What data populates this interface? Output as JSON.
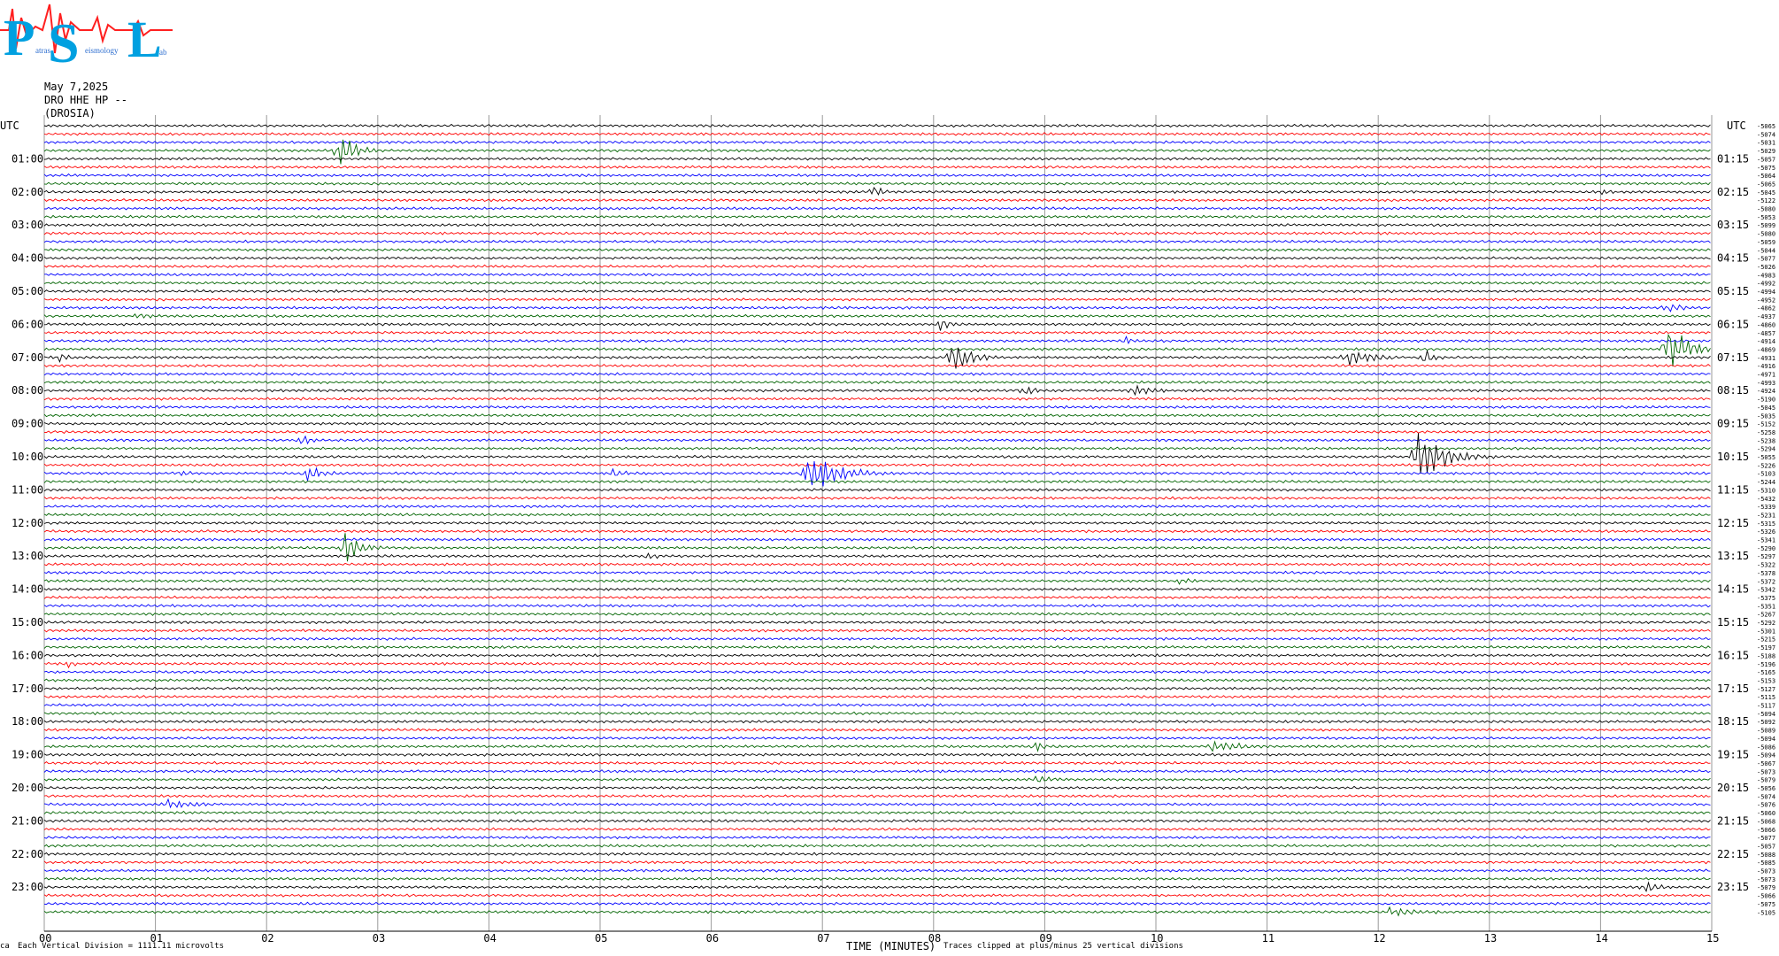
{
  "logo": {
    "letters": [
      "P",
      "S",
      "L"
    ],
    "small_words": [
      "atras",
      "eismology",
      "ab"
    ],
    "colors": {
      "letter": "#00a0e0",
      "wave": "#ff2020"
    }
  },
  "header": {
    "date": "May 7,2025",
    "station": "DRO HHE HP --",
    "location": "(DROSIA)"
  },
  "labels": {
    "utc_left": "UTC",
    "utc_right": "UTC",
    "time_axis": "TIME (MINUTES)",
    "division": "Each Vertical Division = 1111.11 microvolts",
    "clip_note": "Traces clipped at plus/minus 25 vertical divisions",
    "corner_mark": "ca"
  },
  "chart_data": {
    "type": "line",
    "x_axis": {
      "label": "TIME (MINUTES)",
      "range": [
        0,
        15
      ],
      "ticks": [
        "00",
        "01",
        "02",
        "03",
        "04",
        "05",
        "06",
        "07",
        "08",
        "09",
        "10",
        "11",
        "12",
        "13",
        "14",
        "15"
      ]
    },
    "row_minutes": 15,
    "rows_total": 96,
    "trace_color_cycle": [
      "#000000",
      "#ff0000",
      "#0000ff",
      "#006400"
    ],
    "left_hour_labels": [
      "01:00",
      "02:00",
      "03:00",
      "04:00",
      "05:00",
      "06:00",
      "07:00",
      "08:00",
      "09:00",
      "10:00",
      "11:00",
      "12:00",
      "13:00",
      "14:00",
      "15:00",
      "16:00",
      "17:00",
      "18:00",
      "19:00",
      "20:00",
      "21:00",
      "22:00",
      "23:00"
    ],
    "right_hour_labels": [
      "01:15",
      "02:15",
      "03:15",
      "04:15",
      "05:15",
      "06:15",
      "07:15",
      "08:15",
      "09:15",
      "10:15",
      "11:15",
      "12:15",
      "13:15",
      "14:15",
      "15:15",
      "16:15",
      "17:15",
      "18:15",
      "19:15",
      "20:15",
      "21:15",
      "22:15",
      "23:15"
    ],
    "offsets": [
      "-5065",
      "-5074",
      "-5031",
      "-5029",
      "-5057",
      "-5075",
      "-5064",
      "-5065",
      "-5045",
      "-5122",
      "-5080",
      "-5053",
      "-5099",
      "-5080",
      "-5059",
      "-5044",
      "-5077",
      "-5026",
      "-4983",
      "-4992",
      "-4994",
      "-4952",
      "-4862",
      "-4937",
      "-4860",
      "-4857",
      "-4914",
      "-4869",
      "-4931",
      "-4916",
      "-4971",
      "-4993",
      "-4924",
      "-5190",
      "-5045",
      "-5035",
      "-5152",
      "-5258",
      "-5238",
      "-5294",
      "-5055",
      "-5226",
      "-5103",
      "-5244",
      "-5310",
      "-5432",
      "-5339",
      "-5231",
      "-5315",
      "-5326",
      "-5341",
      "-5290",
      "-5297",
      "-5322",
      "-5378",
      "-5372",
      "-5342",
      "-5375",
      "-5351",
      "-5267",
      "-5292",
      "-5301",
      "-5215",
      "-5197",
      "-5188",
      "-5196",
      "-5165",
      "-5153",
      "-5127",
      "-5115",
      "-5117",
      "-5094",
      "-5092",
      "-5089",
      "-5094",
      "-5086",
      "-5094",
      "-5067",
      "-5073",
      "-5079",
      "-5056",
      "-5074",
      "-5076",
      "-5060",
      "-5068",
      "-5066",
      "-5077",
      "-5057",
      "-5088",
      "-5085",
      "-5073",
      "-5073",
      "-5079",
      "-5066",
      "-5075",
      "-5105"
    ],
    "events": [
      {
        "row": 3,
        "minute": 2.65,
        "duration": 0.4,
        "amp": 30
      },
      {
        "row": 8,
        "minute": 7.45,
        "duration": 0.3,
        "amp": 10
      },
      {
        "row": 8,
        "minute": 14.0,
        "duration": 0.3,
        "amp": 6
      },
      {
        "row": 23,
        "minute": 0.8,
        "duration": 0.6,
        "amp": 5
      },
      {
        "row": 22,
        "minute": 14.6,
        "duration": 0.4,
        "amp": 10
      },
      {
        "row": 24,
        "minute": 8.05,
        "duration": 0.3,
        "amp": 12
      },
      {
        "row": 26,
        "minute": 9.7,
        "duration": 0.3,
        "amp": 8
      },
      {
        "row": 27,
        "minute": 14.6,
        "duration": 0.6,
        "amp": 30
      },
      {
        "row": 28,
        "minute": 0.1,
        "duration": 0.3,
        "amp": 9
      },
      {
        "row": 28,
        "minute": 8.15,
        "duration": 0.5,
        "amp": 25
      },
      {
        "row": 28,
        "minute": 11.7,
        "duration": 0.8,
        "amp": 12
      },
      {
        "row": 28,
        "minute": 12.4,
        "duration": 0.3,
        "amp": 12
      },
      {
        "row": 32,
        "minute": 8.8,
        "duration": 0.3,
        "amp": 10
      },
      {
        "row": 32,
        "minute": 9.8,
        "duration": 0.6,
        "amp": 8
      },
      {
        "row": 38,
        "minute": 2.3,
        "duration": 0.3,
        "amp": 8
      },
      {
        "row": 40,
        "minute": 12.35,
        "duration": 0.8,
        "amp": 30
      },
      {
        "row": 42,
        "minute": 2.35,
        "duration": 0.5,
        "amp": 12
      },
      {
        "row": 42,
        "minute": 6.85,
        "duration": 0.8,
        "amp": 30
      },
      {
        "row": 42,
        "minute": 5.1,
        "duration": 0.5,
        "amp": 6
      },
      {
        "row": 42,
        "minute": 1.2,
        "duration": 0.5,
        "amp": 6
      },
      {
        "row": 51,
        "minute": 2.7,
        "duration": 0.4,
        "amp": 25
      },
      {
        "row": 52,
        "minute": 5.4,
        "duration": 0.4,
        "amp": 6
      },
      {
        "row": 55,
        "minute": 10.2,
        "duration": 0.4,
        "amp": 6
      },
      {
        "row": 65,
        "minute": 0.2,
        "duration": 0.3,
        "amp": 6
      },
      {
        "row": 75,
        "minute": 10.5,
        "duration": 0.8,
        "amp": 10
      },
      {
        "row": 75,
        "minute": 8.9,
        "duration": 0.5,
        "amp": 7
      },
      {
        "row": 79,
        "minute": 8.9,
        "duration": 0.6,
        "amp": 6
      },
      {
        "row": 82,
        "minute": 1.1,
        "duration": 0.8,
        "amp": 8
      },
      {
        "row": 92,
        "minute": 14.4,
        "duration": 0.5,
        "amp": 8
      },
      {
        "row": 95,
        "minute": 12.1,
        "duration": 1.2,
        "amp": 6
      }
    ]
  }
}
